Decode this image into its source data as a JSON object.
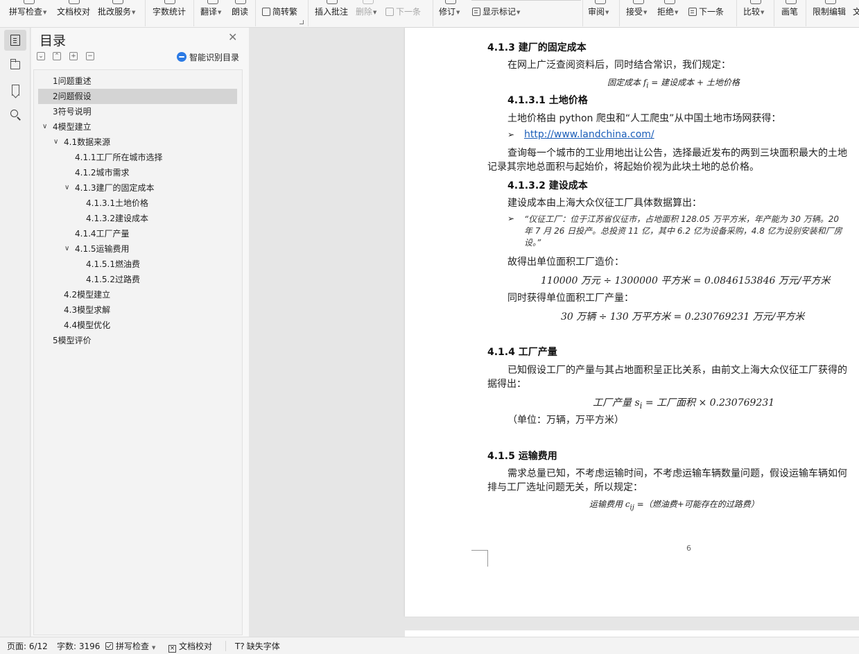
{
  "toolbar": {
    "spell_check": "拼写检查",
    "doc_proof": "文档校对",
    "revise_service": "批改服务",
    "word_count": "字数统计",
    "translate": "翻译",
    "read_aloud": "朗读",
    "simp_trad": "简转繁",
    "insert_comment": "插入批注",
    "delete": "删除",
    "next_comment": "下一条",
    "track_changes": "修订",
    "show_markup": "显示标记",
    "review": "审阅",
    "accept": "接受",
    "reject": "拒绝",
    "next_change": "下一条",
    "compare": "比较",
    "ink": "画笔",
    "restrict_edit": "限制编辑",
    "more_cut": "文"
  },
  "toc": {
    "title": "目录",
    "ai_label": "智能识别目录",
    "items": [
      {
        "label": "1问题重述"
      },
      {
        "label": "2问题假设"
      },
      {
        "label": "3符号说明"
      },
      {
        "label": "4模型建立"
      },
      {
        "label": "4.1数据来源"
      },
      {
        "label": "4.1.1工厂所在城市选择"
      },
      {
        "label": "4.1.2城市需求"
      },
      {
        "label": "4.1.3建厂的固定成本"
      },
      {
        "label": "4.1.3.1土地价格"
      },
      {
        "label": "4.1.3.2建设成本"
      },
      {
        "label": "4.1.4工厂产量"
      },
      {
        "label": "4.1.5运输费用"
      },
      {
        "label": "4.1.5.1燃油费"
      },
      {
        "label": "4.1.5.2过路费"
      },
      {
        "label": "4.2模型建立"
      },
      {
        "label": "4.3模型求解"
      },
      {
        "label": "4.4模型优化"
      },
      {
        "label": "5模型评价"
      }
    ]
  },
  "document": {
    "h_413": "4.1.3   建厂的固定成本",
    "p_413": "在网上广泛查阅资料后，同时结合常识，我们规定：",
    "f_fixed": "固定成本 f",
    "f_fixed_sub": "i",
    "f_fixed_rest": " = 建设成本 + 土地价格",
    "h_4131": "4.1.3.1  土地价格",
    "p_4131": "土地价格由 python 爬虫和“人工爬虫”从中国土地市场网获得：",
    "bullet_mark": "➢",
    "link": "http://www.landchina.com/",
    "p_4131b_line1": "查询每一个城市的工业用地出让公告，选择最近发布的两到三块面积最大的土地",
    "p_4131b_line2": "记录其宗地总面积与起始价，将起始价视为此块土地的总价格。",
    "h_4132": "4.1.3.2  建设成本",
    "p_4132": "建设成本由上海大众仪征工厂具体数据算出：",
    "quote_line1": "“仪征工厂：位于江苏省仪征市，占地面积 128.05 万平方米，年产能为 30 万辆。20",
    "quote_line2": "年 7 月 26 日投产。总投资 11 亿，其中 6.2 亿为设备采购，4.8 亿为设别安装和厂房",
    "quote_line3": "设。”",
    "p_cost": "故得出单位面积工厂造价：",
    "f_cost": "110000 万元 ÷ 1300000 平方米 = 0.0846153846 万元/平方米",
    "p_output": "同时获得单位面积工厂产量：",
    "f_output": "30 万辆 ÷ 130 万平方米 = 0.230769231 万元/平方米",
    "h_414": "4.1.4   工厂产量",
    "p_414_line1": "已知假设工厂的产量与其占地面积呈正比关系，由前文上海大众仪征工厂获得的",
    "p_414_line2": "据得出：",
    "f_plant": "工厂产量 s",
    "f_plant_sub": "i",
    "f_plant_rest": " = 工厂面积 × 0.230769231",
    "p_unit": "（单位：万辆，万平方米）",
    "h_415": "4.1.5   运输费用",
    "p_415_line1": "需求总量已知，不考虑运输时间，不考虑运输车辆数量问题，假设运输车辆如何",
    "p_415_line2": "排与工厂选址问题无关，所以规定：",
    "f_transport": "运输费用 c",
    "f_transport_sub": "ij",
    "f_transport_rest": " =（燃油费+可能存在的过路费）",
    "page_number": "6"
  },
  "status": {
    "page": "页面: 6/12",
    "words": "字数: 3196",
    "spell": "拼写检查",
    "proof": "文档校对",
    "missing_font": "缺失字体"
  }
}
